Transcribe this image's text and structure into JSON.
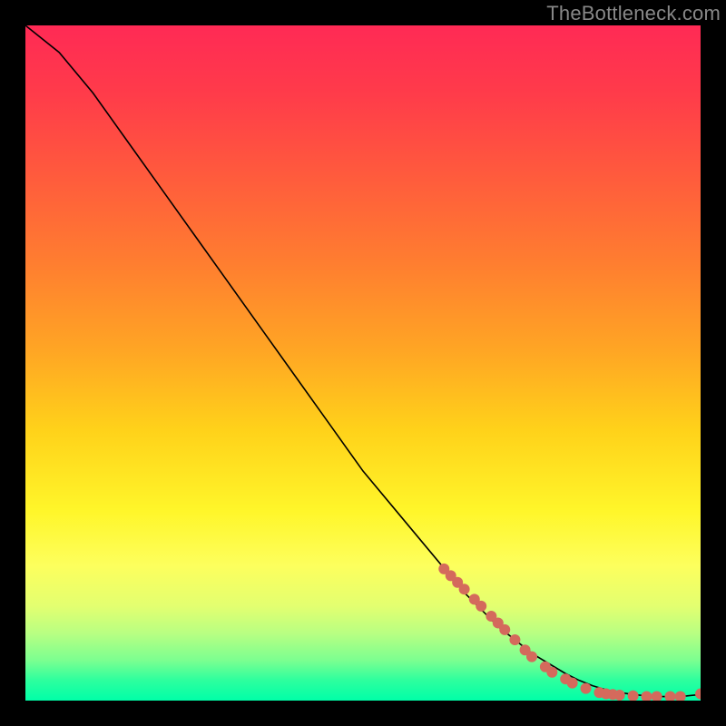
{
  "watermark": "TheBottleneck.com",
  "colors": {
    "page_bg": "#000000",
    "curve": "#000000",
    "marker": "#d46a5c",
    "gradient_top": "#ff2a55",
    "gradient_mid": "#fff62a",
    "gradient_bottom": "#00ffa8"
  },
  "chart_data": {
    "type": "line",
    "title": "",
    "xlabel": "",
    "ylabel": "",
    "xlim": [
      0,
      100
    ],
    "ylim": [
      0,
      100
    ],
    "grid": false,
    "legend": false,
    "series": [
      {
        "name": "curve",
        "x": [
          0,
          5,
          10,
          15,
          20,
          25,
          30,
          35,
          40,
          45,
          50,
          55,
          60,
          65,
          70,
          75,
          80,
          82,
          84,
          86,
          88,
          90,
          92,
          94,
          96,
          98,
          100
        ],
        "y": [
          100,
          96,
          90,
          83,
          76,
          69,
          62,
          55,
          48,
          41,
          34,
          28,
          22,
          16,
          11,
          7,
          4,
          3,
          2.2,
          1.6,
          1.2,
          0.9,
          0.7,
          0.6,
          0.6,
          0.7,
          0.9
        ]
      }
    ],
    "markers": [
      {
        "x": 62,
        "y": 19.5
      },
      {
        "x": 63,
        "y": 18.5
      },
      {
        "x": 64,
        "y": 17.5
      },
      {
        "x": 65,
        "y": 16.5
      },
      {
        "x": 66.5,
        "y": 15
      },
      {
        "x": 67.5,
        "y": 14
      },
      {
        "x": 69,
        "y": 12.5
      },
      {
        "x": 70,
        "y": 11.5
      },
      {
        "x": 71,
        "y": 10.5
      },
      {
        "x": 72.5,
        "y": 9
      },
      {
        "x": 74,
        "y": 7.5
      },
      {
        "x": 75,
        "y": 6.5
      },
      {
        "x": 77,
        "y": 5
      },
      {
        "x": 78,
        "y": 4.2
      },
      {
        "x": 80,
        "y": 3.2
      },
      {
        "x": 81,
        "y": 2.6
      },
      {
        "x": 83,
        "y": 1.8
      },
      {
        "x": 85,
        "y": 1.2
      },
      {
        "x": 86,
        "y": 1.0
      },
      {
        "x": 87,
        "y": 0.9
      },
      {
        "x": 88,
        "y": 0.8
      },
      {
        "x": 90,
        "y": 0.7
      },
      {
        "x": 92,
        "y": 0.6
      },
      {
        "x": 93.5,
        "y": 0.6
      },
      {
        "x": 95.5,
        "y": 0.6
      },
      {
        "x": 97,
        "y": 0.6
      },
      {
        "x": 100,
        "y": 1.0
      }
    ],
    "marker_radius_px": 6
  }
}
